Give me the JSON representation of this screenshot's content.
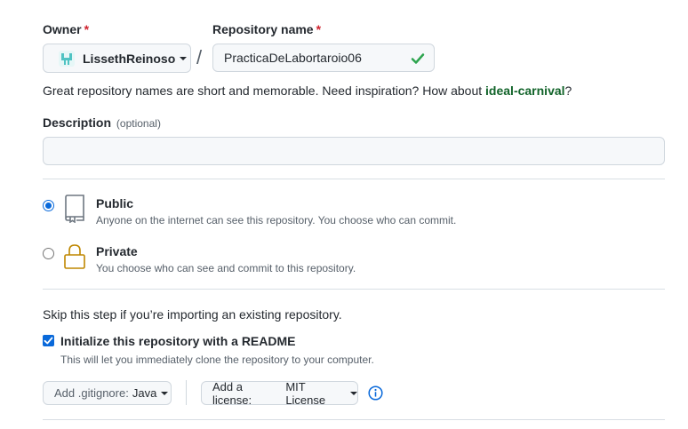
{
  "owner": {
    "label": "Owner",
    "required_mark": "*",
    "value": "LissethReinoso"
  },
  "separator": "/",
  "repo_name": {
    "label": "Repository name",
    "required_mark": "*",
    "value": "PracticaDeLabortaroio06"
  },
  "suggestion": {
    "text": "Great repository names are short and memorable. Need inspiration? How about ",
    "name": "ideal-carnival",
    "end": "?"
  },
  "description": {
    "label": "Description",
    "optional": "(optional)",
    "value": ""
  },
  "visibility": {
    "public": {
      "title": "Public",
      "desc": "Anyone on the internet can see this repository. You choose who can commit.",
      "selected": true
    },
    "private": {
      "title": "Private",
      "desc": "You choose who can see and commit to this repository.",
      "selected": false
    }
  },
  "init": {
    "skip_text": "Skip this step if you’re importing an existing repository.",
    "readme_label": "Initialize this repository with a README",
    "readme_checked": true,
    "readme_note": "This will let you immediately clone the repository to your computer."
  },
  "gitignore": {
    "prefix": "Add .gitignore:",
    "value": "Java"
  },
  "license": {
    "prefix": "Add a license:",
    "value": "MIT License"
  },
  "colors": {
    "accent": "#0969da",
    "success": "#2da44e",
    "required": "#cf222e"
  }
}
